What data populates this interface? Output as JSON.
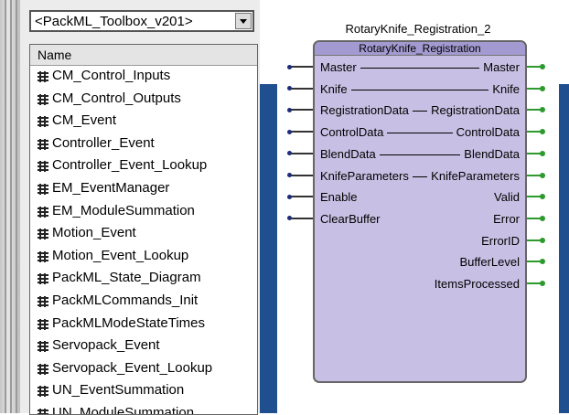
{
  "toolbox": {
    "selected": "<PackML_Toolbox_v201>",
    "column_header": "Name",
    "items": [
      "CM_Control_Inputs",
      "CM_Control_Outputs",
      "CM_Event",
      "Controller_Event",
      "Controller_Event_Lookup",
      "EM_EventManager",
      "EM_ModuleSummation",
      "Motion_Event",
      "Motion_Event_Lookup",
      "PackML_State_Diagram",
      "PackMLCommands_Init",
      "PackMLModeStateTimes",
      "Servopack_Event",
      "Servopack_Event_Lookup",
      "UN_EventSummation",
      "UN_ModuleSummation"
    ]
  },
  "function_block": {
    "instance_name": "RotaryKnife_Registration_2",
    "type_name": "RotaryKnife_Registration",
    "through_pins": [
      {
        "in": "Master",
        "out": "Master"
      },
      {
        "in": "Knife",
        "out": "Knife"
      },
      {
        "in": "RegistrationData",
        "out": "RegistrationData"
      },
      {
        "in": "ControlData",
        "out": "ControlData"
      },
      {
        "in": "BlendData",
        "out": "BlendData"
      },
      {
        "in": "KnifeParameters",
        "out": "KnifeParameters"
      }
    ],
    "inputs": [
      "Enable",
      "ClearBuffer"
    ],
    "outputs": [
      "Valid",
      "Error",
      "ErrorID",
      "BufferLevel",
      "ItemsProcessed"
    ]
  },
  "colors": {
    "background_band": "#1f4f8f",
    "block_body": "#c8c0e4",
    "block_header": "#a29ad0",
    "output_pin": "#2d9a2d"
  },
  "icons": {
    "toolbox_item": "function-block-icon",
    "dropdown": "chevron-down-icon"
  }
}
